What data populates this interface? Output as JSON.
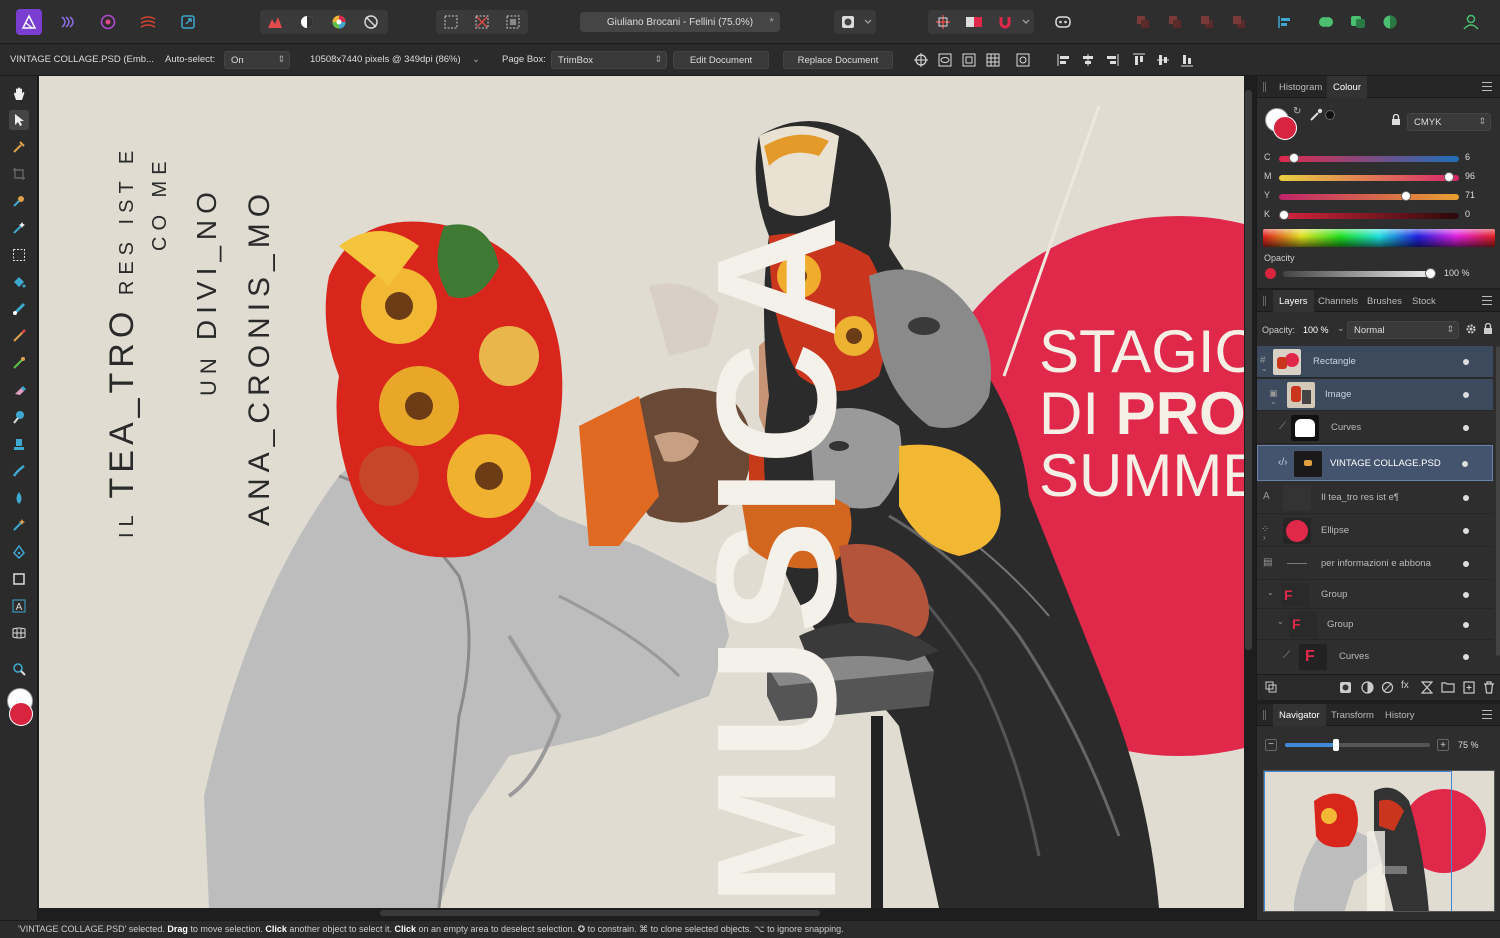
{
  "toolbar": {
    "document_title": "Giuliano Brocani - Fellini (75.0%)",
    "close_glyph": "*"
  },
  "context": {
    "file_label": "VINTAGE COLLAGE.PSD (Emb...",
    "auto_select_label": "Auto-select:",
    "auto_select_value": "On",
    "dimensions": "10508x7440 pixels @ 349dpi (86%)",
    "page_box_label": "Page Box:",
    "page_box_value": "TrimBox",
    "edit_document": "Edit Document",
    "replace_document": "Replace Document"
  },
  "canvas": {
    "line1_a": "IL",
    "line1_b": "TEA_TRO",
    "line1_c": "RES IST E",
    "line2": "CO  ME",
    "line3_a": "UN",
    "line3_b": "DIVI_NO",
    "line4": "ANA_CRONIS_MO",
    "musica": "MUSICA",
    "stagione_1": "STAGIONE",
    "stagione_2a": "DI ",
    "stagione_2b": "PROSA",
    "stagione_3": "SUMMER"
  },
  "colour_panel": {
    "tabs": [
      "Histogram",
      "Colour"
    ],
    "active_tab": "Colour",
    "model": "CMYK",
    "channels": [
      {
        "label": "C",
        "value": "6",
        "fraction": 0.06
      },
      {
        "label": "M",
        "value": "96",
        "fraction": 0.96
      },
      {
        "label": "Y",
        "value": "71",
        "fraction": 0.71
      },
      {
        "label": "K",
        "value": "0",
        "fraction": 0.0
      }
    ],
    "opacity_label": "Opacity",
    "opacity_value": "100 %",
    "current_colour": "#d8243f"
  },
  "layers_panel": {
    "tabs": [
      "Layers",
      "Channels",
      "Brushes",
      "Stock"
    ],
    "active_tab": "Layers",
    "opacity_label": "Opacity:",
    "opacity_value": "100 %",
    "blend_mode": "Normal",
    "layers": [
      {
        "name": "Rectangle"
      },
      {
        "name": "Image"
      },
      {
        "name": "Curves"
      },
      {
        "name": "VINTAGE COLLAGE.PSD"
      },
      {
        "name": "Il tea_tro res ist e¶"
      },
      {
        "name": "Ellipse"
      },
      {
        "name": "per informazioni e abbona"
      },
      {
        "name": "Group"
      },
      {
        "name": "Group"
      },
      {
        "name": "Curves"
      }
    ]
  },
  "navigator_panel": {
    "tabs": [
      "Navigator",
      "Transform",
      "History"
    ],
    "active_tab": "Navigator",
    "zoom_value": "75 %",
    "zoom_fraction": 0.35
  },
  "status": {
    "part1": "'VINTAGE COLLAGE.PSD' selected. ",
    "drag": "Drag",
    "part2": " to move selection. ",
    "click1": "Click",
    "part3": " another object to select it. ",
    "click2": "Click",
    "part4": " on an empty area to deselect selection. ✪ to constrain. ⌘ to clone selected objects. ⌥ to ignore snapping."
  },
  "colors": {
    "accent_red": "#e0284a",
    "canvas_bg": "#e0dcd2",
    "selection_blue": "#44546e"
  }
}
